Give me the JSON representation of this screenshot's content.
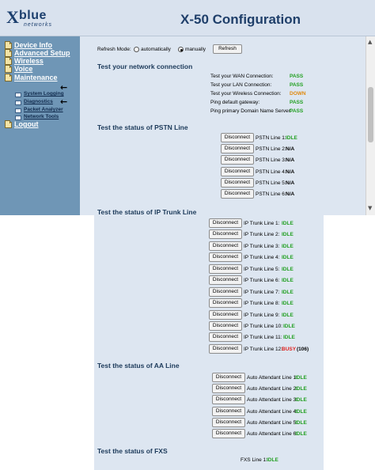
{
  "header": {
    "logo_word": "blue",
    "logo_letter": "X",
    "logo_sub": "networks",
    "title": "X-50 Configuration"
  },
  "sidebar": {
    "items": [
      {
        "label": "Device Info"
      },
      {
        "label": "Advanced Setup"
      },
      {
        "label": "Wireless"
      },
      {
        "label": "Voice"
      },
      {
        "label": "Maintenance"
      }
    ],
    "sub_items": [
      {
        "label": "System Logging"
      },
      {
        "label": "Diagnostics"
      },
      {
        "label": "Packet Analyzer"
      },
      {
        "label": "Network Tools"
      }
    ],
    "logout": "Logout"
  },
  "refresh": {
    "label": "Refresh Mode:",
    "opt_auto": "automatically",
    "opt_manual": "manually",
    "selected": "manually",
    "button": "Refresh"
  },
  "network": {
    "title": "Test your network connection",
    "rows": [
      {
        "label": "Test your WAN Connection:",
        "status": "PASS"
      },
      {
        "label": "Test your LAN Connection:",
        "status": "PASS"
      },
      {
        "label": "Test your Wireless Connection:",
        "status": "DOWN"
      },
      {
        "label": "Ping default gateway:",
        "status": "PASS"
      },
      {
        "label": "Ping primary Domain Name Server:",
        "status": "PASS"
      }
    ]
  },
  "pstn": {
    "title": "Test the status of PSTN Line",
    "button": "Disconnect",
    "rows": [
      {
        "label": "PSTN Line 1:",
        "status": "IDLE"
      },
      {
        "label": "PSTN Line 2:",
        "status": "N/A"
      },
      {
        "label": "PSTN Line 3:",
        "status": "N/A"
      },
      {
        "label": "PSTN Line 4:",
        "status": "N/A"
      },
      {
        "label": "PSTN Line 5:",
        "status": "N/A"
      },
      {
        "label": "PSTN Line 6:",
        "status": "N/A"
      }
    ]
  },
  "trunk": {
    "title": "Test the status of IP Trunk Line",
    "button": "Disconnect",
    "rows": [
      {
        "label": "IP Trunk Line 1:",
        "status": "IDLE"
      },
      {
        "label": "IP Trunk Line 2:",
        "status": "IDLE"
      },
      {
        "label": "IP Trunk Line 3:",
        "status": "IDLE"
      },
      {
        "label": "IP Trunk Line 4:",
        "status": "IDLE"
      },
      {
        "label": "IP Trunk Line 5:",
        "status": "IDLE"
      },
      {
        "label": "IP Trunk Line 6:",
        "status": "IDLE"
      },
      {
        "label": "IP Trunk Line 7:",
        "status": "IDLE"
      },
      {
        "label": "IP Trunk Line 8:",
        "status": "IDLE"
      },
      {
        "label": "IP Trunk Line 9:",
        "status": "IDLE"
      },
      {
        "label": "IP Trunk Line 10:",
        "status": "IDLE"
      },
      {
        "label": "IP Trunk Line 11:",
        "status": "IDLE"
      },
      {
        "label": "IP Trunk Line 12:",
        "status": "BUSY",
        "extra": "(106)"
      }
    ]
  },
  "aa": {
    "title": "Test the status of AA Line",
    "button": "Disconnect",
    "rows": [
      {
        "label": "Auto Attendant Line 1:",
        "status": "IDLE"
      },
      {
        "label": "Auto Attendant Line 2:",
        "status": "IDLE"
      },
      {
        "label": "Auto Attendant Line 3:",
        "status": "IDLE"
      },
      {
        "label": "Auto Attendant Line 4:",
        "status": "IDLE"
      },
      {
        "label": "Auto Attendant Line 5:",
        "status": "IDLE"
      },
      {
        "label": "Auto Attendant Line 6:",
        "status": "IDLE"
      }
    ]
  },
  "fxs": {
    "title": "Test the status of FXS",
    "label": "FXS Line 1:",
    "status": "IDLE"
  }
}
